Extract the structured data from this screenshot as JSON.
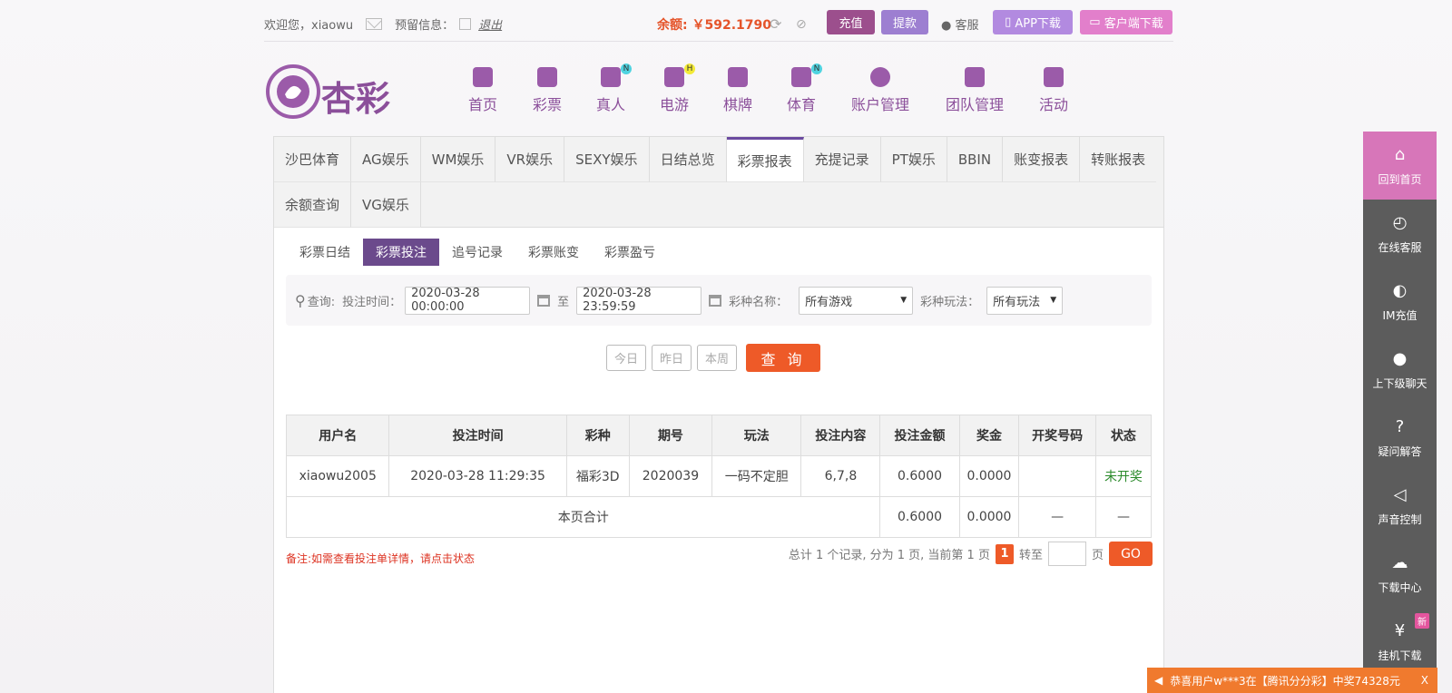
{
  "header": {
    "welcome": "欢迎您，xiaowu",
    "reserve_label": "预留信息：",
    "logout": "退出",
    "balance_label": "余额:",
    "balance": "￥592.1790",
    "recharge": "充值",
    "withdraw": "提款",
    "service": "客服",
    "app_download": "APP下载",
    "client_download": "客户端下载"
  },
  "brand": {
    "logo_text": "杏彩"
  },
  "nav": [
    {
      "label": "首页"
    },
    {
      "label": "彩票"
    },
    {
      "label": "真人",
      "badge": "N"
    },
    {
      "label": "电游",
      "badge": "H"
    },
    {
      "label": "棋牌"
    },
    {
      "label": "体育",
      "badge": "N"
    },
    {
      "label": "账户管理"
    },
    {
      "label": "团队管理"
    },
    {
      "label": "活动"
    }
  ],
  "tabs": [
    "沙巴体育",
    "AG娱乐",
    "WM娱乐",
    "VR娱乐",
    "SEXY娱乐",
    "日结总览",
    "彩票报表",
    "充提记录",
    "PT娱乐",
    "BBIN",
    "账变报表",
    "转账报表",
    "余额查询",
    "VG娱乐"
  ],
  "subtabs": [
    "彩票日结",
    "彩票投注",
    "追号记录",
    "彩票账变",
    "彩票盈亏"
  ],
  "filter": {
    "query": "查询:",
    "time_label": "投注时间：",
    "start": "2020-03-28 00:00:00",
    "to": "至",
    "end": "2020-03-28 23:59:59",
    "game_label": "彩种名称：",
    "game_value": "所有游戏",
    "play_label": "彩种玩法：",
    "play_value": "所有玩法"
  },
  "quick": {
    "today": "今日",
    "yesterday": "昨日",
    "week": "本周",
    "search": "查 询"
  },
  "table": {
    "headers": [
      "用户名",
      "投注时间",
      "彩种",
      "期号",
      "玩法",
      "投注内容",
      "投注金额",
      "奖金",
      "开奖号码",
      "状态"
    ],
    "row": [
      "xiaowu2005",
      "2020-03-28 11:29:35",
      "福彩3D",
      "2020039",
      "一码不定胆",
      "6,7,8",
      "0.6000",
      "0.0000",
      "",
      "未开奖"
    ],
    "total": {
      "label": "本页合计",
      "amount": "0.6000",
      "bonus": "0.0000",
      "draw": "—",
      "status": "—"
    }
  },
  "note": "备注:如需查看投注单详情，请点击状态",
  "pager": {
    "summary": "总计 1 个记录, 分为 1 页, 当前第 1 页",
    "current": "1",
    "jump": "转至",
    "page": "页",
    "go": "GO"
  },
  "sidebar": [
    {
      "label": "回到首页",
      "icon": "home-icon"
    },
    {
      "label": "在线客服",
      "icon": "24h-icon"
    },
    {
      "label": "IM充值",
      "icon": "im-icon"
    },
    {
      "label": "上下级聊天",
      "icon": "chat-icon"
    },
    {
      "label": "疑问解答",
      "icon": "question-icon"
    },
    {
      "label": "声音控制",
      "icon": "sound-icon"
    },
    {
      "label": "下载中心",
      "icon": "download-icon"
    },
    {
      "label": "挂机下载",
      "icon": "money-icon",
      "badge": "新"
    }
  ],
  "ticker": {
    "text": "恭喜用户w***3在【腾讯分分彩】中奖74328元",
    "close": "X"
  },
  "colors": {
    "brand": "#8b4f9a",
    "accent": "#ee5a28",
    "tab_active": "#6b4a8c"
  }
}
